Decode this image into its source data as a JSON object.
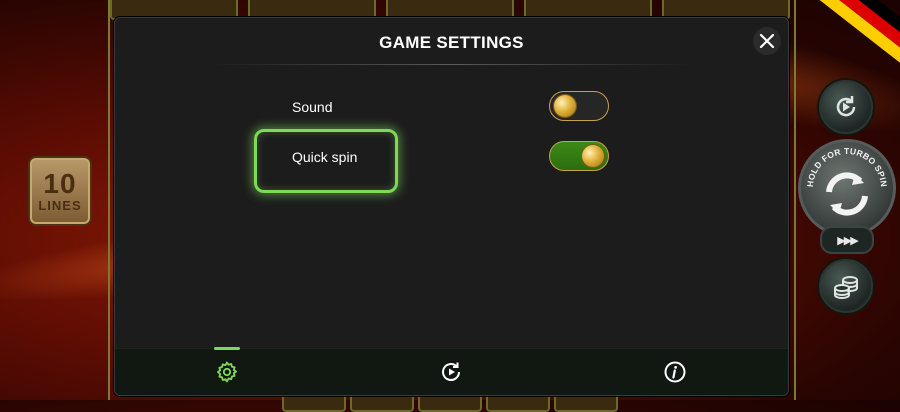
{
  "lines_badge": {
    "number": "10",
    "label": "LINES"
  },
  "spin_control": {
    "turbo_hint": "HOLD FOR TURBO SPIN",
    "fast_forward": "▶▶▶"
  },
  "modal": {
    "title": "GAME SETTINGS",
    "close_icon": "close-icon",
    "settings": [
      {
        "label": "Sound",
        "enabled": false
      },
      {
        "label": "Quick spin",
        "enabled": true,
        "focused": true
      }
    ],
    "tabs": [
      {
        "icon": "gear-icon",
        "active": true
      },
      {
        "icon": "autoplay-icon",
        "active": false
      },
      {
        "icon": "info-icon",
        "active": false
      }
    ]
  },
  "colors": {
    "accent": "#7ed957",
    "toggle_on": "#3c8a16",
    "toggle_border": "#c9a14a",
    "modal_bg": "#1c1c1c",
    "flag": [
      "#000000",
      "#dd0000",
      "#ffce00"
    ]
  }
}
